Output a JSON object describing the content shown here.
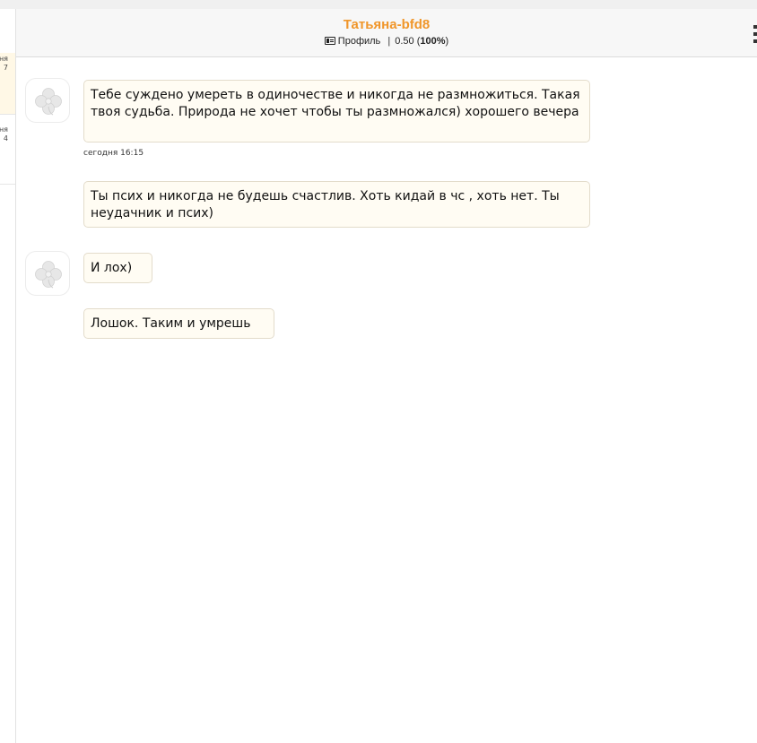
{
  "sidebar": {
    "items": [
      {
        "line1": "ня",
        "line2": "7"
      },
      {
        "line1": "ня",
        "line2": "4"
      }
    ]
  },
  "chat": {
    "contact_name": "Татьяна-bfd8",
    "profile_label": "Профиль",
    "separator": "|",
    "rating": "0.50",
    "rating_percent": "100%"
  },
  "messages": [
    {
      "text": "Тебе суждено умереть в одиночестве и никогда не размножиться. Такая твоя судьба. Природа не хочет чтобы ты размножался) хорошего вечера",
      "time": "сегодня 16:15"
    },
    {
      "text": "Ты псих и никогда не будешь счастлив. Хоть кидай в чс , хоть нет. Ты неудачник и псих)"
    },
    {
      "text": "И лох)"
    },
    {
      "text": "Лошок. Таким и умрешь"
    }
  ],
  "icons": {
    "avatar": "clover-avatar-icon",
    "profile": "profile-card-icon",
    "menu": "vertical-dots-menu-icon"
  },
  "colors": {
    "accent": "#f0962a",
    "bubble_bg": "#fffcf3",
    "bubble_border": "#e3dccb",
    "active_conversation_bg": "#fff8e6"
  }
}
